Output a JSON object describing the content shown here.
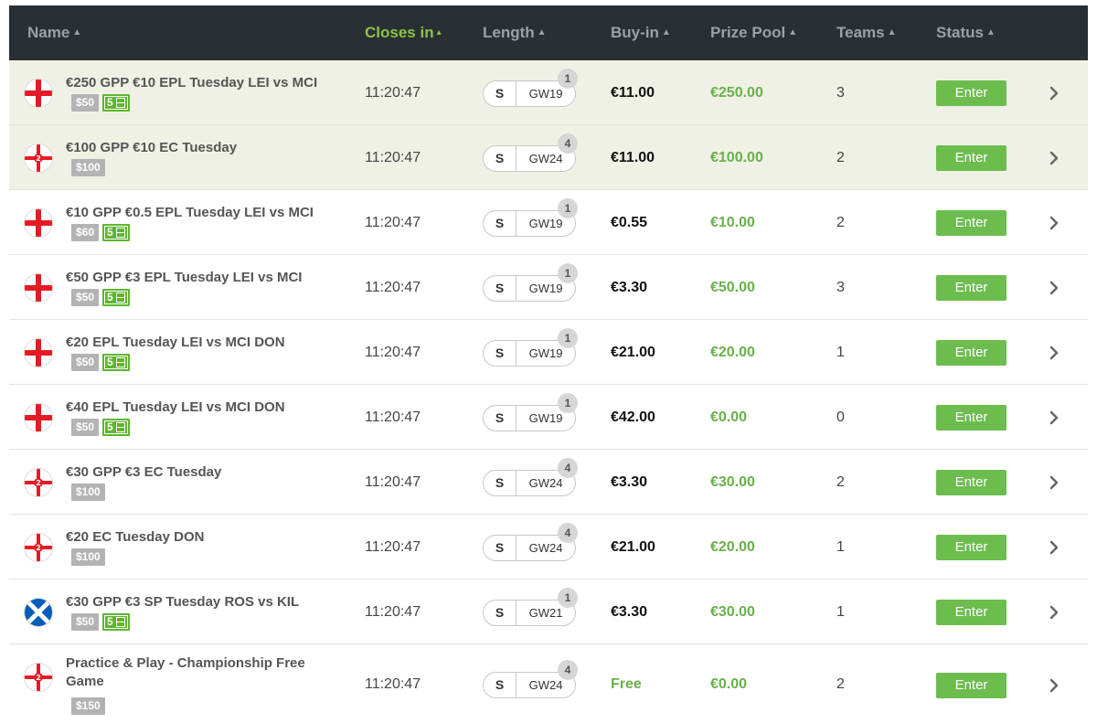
{
  "header": {
    "name": "Name",
    "closes_in": "Closes in",
    "length": "Length",
    "buy_in": "Buy-in",
    "prize_pool": "Prize Pool",
    "teams": "Teams",
    "status": "Status"
  },
  "colors": {
    "header_bg": "#2a2f33",
    "accent_green": "#6cbd4e",
    "highlight_row": "#eff1e5"
  },
  "rows": [
    {
      "flag": "england-flag-icon",
      "name": "€250 GPP €10 EPL Tuesday LEI vs MCI",
      "price": "$50",
      "count": "5",
      "closes": "11:20:47",
      "len_s": "S",
      "gw": "GW19",
      "gw_num": "1",
      "buyin": "€11.00",
      "prize": "€250.00",
      "teams": "3",
      "status": "Enter"
    },
    {
      "flag": "england-2-flag-icon",
      "name": "€100 GPP €10 EC Tuesday",
      "price": "$100",
      "count": "",
      "closes": "11:20:47",
      "len_s": "S",
      "gw": "GW24",
      "gw_num": "4",
      "buyin": "€11.00",
      "prize": "€100.00",
      "teams": "2",
      "status": "Enter"
    },
    {
      "flag": "england-flag-icon",
      "name": "€10 GPP €0.5 EPL Tuesday LEI vs MCI",
      "price": "$60",
      "count": "5",
      "closes": "11:20:47",
      "len_s": "S",
      "gw": "GW19",
      "gw_num": "1",
      "buyin": "€0.55",
      "prize": "€10.00",
      "teams": "2",
      "status": "Enter"
    },
    {
      "flag": "england-flag-icon",
      "name": "€50 GPP €3 EPL Tuesday LEI vs MCI",
      "price": "$50",
      "count": "5",
      "closes": "11:20:47",
      "len_s": "S",
      "gw": "GW19",
      "gw_num": "1",
      "buyin": "€3.30",
      "prize": "€50.00",
      "teams": "3",
      "status": "Enter"
    },
    {
      "flag": "england-flag-icon",
      "name": "€20 EPL Tuesday LEI vs MCI DON",
      "price": "$50",
      "count": "5",
      "closes": "11:20:47",
      "len_s": "S",
      "gw": "GW19",
      "gw_num": "1",
      "buyin": "€21.00",
      "prize": "€20.00",
      "teams": "1",
      "status": "Enter"
    },
    {
      "flag": "england-flag-icon",
      "name": "€40 EPL Tuesday LEI vs MCI DON",
      "price": "$50",
      "count": "5",
      "closes": "11:20:47",
      "len_s": "S",
      "gw": "GW19",
      "gw_num": "1",
      "buyin": "€42.00",
      "prize": "€0.00",
      "teams": "0",
      "status": "Enter"
    },
    {
      "flag": "england-2-flag-icon",
      "name": "€30 GPP €3 EC Tuesday",
      "price": "$100",
      "count": "",
      "closes": "11:20:47",
      "len_s": "S",
      "gw": "GW24",
      "gw_num": "4",
      "buyin": "€3.30",
      "prize": "€30.00",
      "teams": "2",
      "status": "Enter"
    },
    {
      "flag": "england-2-flag-icon",
      "name": "€20 EC Tuesday DON",
      "price": "$100",
      "count": "",
      "closes": "11:20:47",
      "len_s": "S",
      "gw": "GW24",
      "gw_num": "4",
      "buyin": "€21.00",
      "prize": "€20.00",
      "teams": "1",
      "status": "Enter"
    },
    {
      "flag": "scotland-flag-icon",
      "name": "€30 GPP €3 SP Tuesday ROS vs KIL",
      "price": "$50",
      "count": "5",
      "closes": "11:20:47",
      "len_s": "S",
      "gw": "GW21",
      "gw_num": "1",
      "buyin": "€3.30",
      "prize": "€30.00",
      "teams": "1",
      "status": "Enter"
    },
    {
      "flag": "england-2-flag-icon",
      "name": "Practice & Play - Championship Free Game",
      "price": "$150",
      "count": "",
      "closes": "11:20:47",
      "len_s": "S",
      "gw": "GW24",
      "gw_num": "4",
      "buyin": "Free",
      "prize": "€0.00",
      "teams": "2",
      "status": "Enter",
      "free": true,
      "tall": true
    }
  ]
}
